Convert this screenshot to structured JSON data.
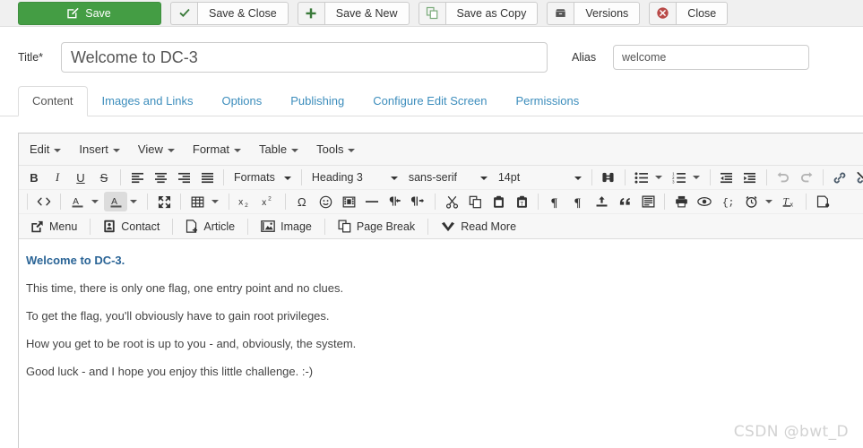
{
  "toolbar": {
    "save": {
      "label": "Save",
      "icon": "edit-square-icon"
    },
    "buttons": [
      {
        "label": "Save & Close",
        "icon": "check-icon",
        "name": "save-and-close"
      },
      {
        "label": "Save & New",
        "icon": "plus-icon",
        "name": "save-and-new"
      },
      {
        "label": "Save as Copy",
        "icon": "copy-icon",
        "name": "save-as-copy"
      },
      {
        "label": "Versions",
        "icon": "archive-icon",
        "name": "versions"
      },
      {
        "label": "Close",
        "icon": "close-circle-icon",
        "name": "close"
      }
    ]
  },
  "form": {
    "title_label": "Title",
    "title_required_mark": "*",
    "title_value": "Welcome to DC-3",
    "title_placeholder": "",
    "alias_label": "Alias",
    "alias_value": "welcome",
    "alias_placeholder": ""
  },
  "tabs": [
    {
      "label": "Content",
      "active": true
    },
    {
      "label": "Images and Links",
      "active": false
    },
    {
      "label": "Options",
      "active": false
    },
    {
      "label": "Publishing",
      "active": false
    },
    {
      "label": "Configure Edit Screen",
      "active": false
    },
    {
      "label": "Permissions",
      "active": false
    }
  ],
  "editor": {
    "menubar": [
      "Edit",
      "Insert",
      "View",
      "Format",
      "Table",
      "Tools"
    ],
    "row1": {
      "bold": "B",
      "italic": "I",
      "underline": "U",
      "strikethrough": "S",
      "formats_label": "Formats",
      "block_format": "Heading 3",
      "font_family": "sans-serif",
      "font_size": "14pt"
    },
    "row3_buttons": [
      {
        "label": "Menu",
        "icon": "menu-link-icon"
      },
      {
        "label": "Contact",
        "icon": "contact-card-icon"
      },
      {
        "label": "Article",
        "icon": "article-page-icon"
      },
      {
        "label": "Image",
        "icon": "image-icon"
      },
      {
        "label": "Page Break",
        "icon": "page-break-icon"
      },
      {
        "label": "Read More",
        "icon": "chevron-down-icon"
      }
    ],
    "content": {
      "heading": "Welcome to DC-3.",
      "paragraphs": [
        "This time, there is only one flag, one entry point and no clues.",
        "To get the flag, you'll obviously have to gain root privileges.",
        "How you get to be root is up to you - and, obviously, the system.",
        "Good luck - and I hope you enjoy this little challenge.  :-)"
      ]
    }
  },
  "watermark": "CSDN @bwt_D",
  "colors": {
    "save_green": "#449d44",
    "tab_link": "#3c8dbc",
    "heading_blue": "#2a6496",
    "close_red": "#b94a48"
  }
}
